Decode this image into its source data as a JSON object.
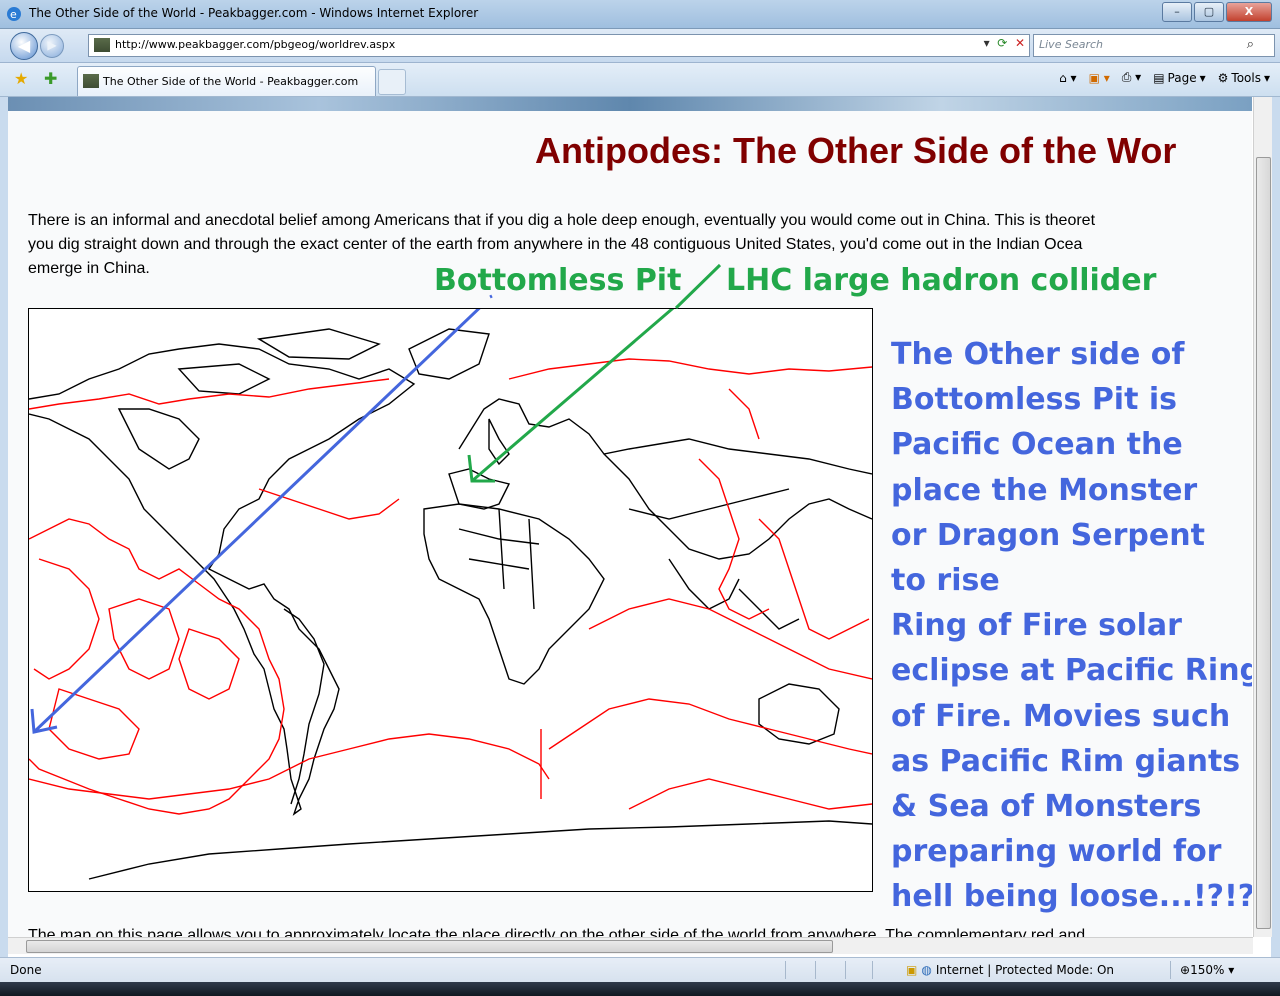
{
  "window": {
    "title": "The Other Side of the World - Peakbagger.com - Windows Internet Explorer",
    "minimize": "–",
    "maximize": "▢",
    "close": "X"
  },
  "nav": {
    "back": "◀",
    "forward": "▶",
    "url": "http://www.peakbagger.com/pbgeog/worldrev.aspx",
    "search_placeholder": "Live Search"
  },
  "tab": {
    "label": "The Other Side of the World - Peakbagger.com"
  },
  "commands": {
    "page": "Page",
    "tools": "Tools"
  },
  "page": {
    "heading": "Antipodes: The Other Side of the Wor",
    "para": [
      "There is an informal and anecdotal belief among Americans that if you dig a hole deep enough, eventually you would come out in China. This is theoret",
      "you dig straight down and through the exact center of the earth from anywhere in the 48 contiguous United States, you'd come out in the Indian Ocea",
      "emerge in China."
    ],
    "bottom_line": "The map on this page allows you to approximately locate the place directly on the other side of the world from anywhere. The complementary red and"
  },
  "annotations": {
    "bottomless_pit": "Bottomless Pit",
    "lhc": "LHC large hadron collider",
    "blue_lines": [
      "The Other side of",
      "Bottomless Pit is",
      "Pacific Ocean the",
      "place the Monster",
      "or Dragon Serpent",
      "to rise",
      "Ring of Fire solar",
      "eclipse at Pacific Ring",
      "of Fire. Movies such",
      "as Pacific Rim giants",
      "& Sea of Monsters",
      "preparing world for",
      "hell being loose...!?!?"
    ],
    "colors": {
      "green": "#22a84a",
      "blue": "#4466dd"
    }
  },
  "status": {
    "done": "Done",
    "zone": "Internet | Protected Mode: On",
    "zoom": "150%"
  },
  "icons": [
    "ie-logo-icon",
    "back-icon",
    "forward-icon",
    "refresh-icon",
    "stop-icon",
    "search-icon",
    "favorites-star-icon",
    "add-favorites-icon",
    "home-icon",
    "feeds-icon",
    "print-icon",
    "page-icon",
    "tools-gear-icon",
    "globe-icon",
    "lock-icon",
    "zoom-icon"
  ]
}
